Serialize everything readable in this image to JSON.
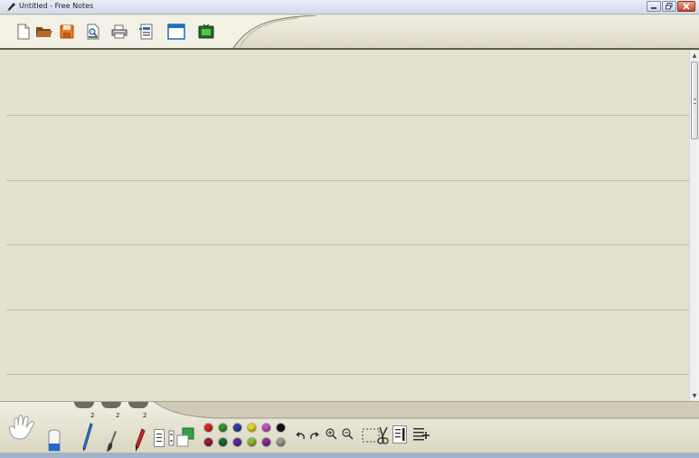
{
  "window": {
    "title": "Untitled - Free Notes",
    "controls": [
      "minimize",
      "maximize",
      "close"
    ]
  },
  "toolbar": {
    "buttons": [
      {
        "name": "new",
        "icon": "new-document-icon"
      },
      {
        "name": "open",
        "icon": "folder-open-icon"
      },
      {
        "name": "save",
        "icon": "save-disk-icon"
      },
      {
        "name": "print-preview",
        "icon": "print-preview-icon"
      },
      {
        "name": "print",
        "icon": "printer-icon"
      },
      {
        "name": "settings",
        "icon": "page-settings-icon"
      },
      {
        "name": "window",
        "icon": "window-icon"
      },
      {
        "name": "monitor",
        "icon": "monitor-icon"
      }
    ]
  },
  "page": {
    "ruled_lines": 5
  },
  "bottom_toolbar": {
    "pen_sizes": [
      "2",
      "2",
      "2"
    ],
    "colors_top": [
      "#d6262a",
      "#2f9a2f",
      "#2e3fa8",
      "#f0d21a",
      "#c04fbe",
      "#101010"
    ],
    "colors_bottom": [
      "#9a1a3a",
      "#1d6a30",
      "#5a2a9a",
      "#8ab830",
      "#8a2a8a",
      "#9a9a9a"
    ],
    "tools": [
      "hand-icon",
      "eraser-icon",
      "pencil-icon",
      "brush-icon",
      "marker-icon"
    ],
    "actions": [
      "undo-icon",
      "redo-icon",
      "zoom-in-icon",
      "zoom-out-icon",
      "select-cut-icon",
      "insert-text-icon",
      "add-page-icon"
    ]
  }
}
